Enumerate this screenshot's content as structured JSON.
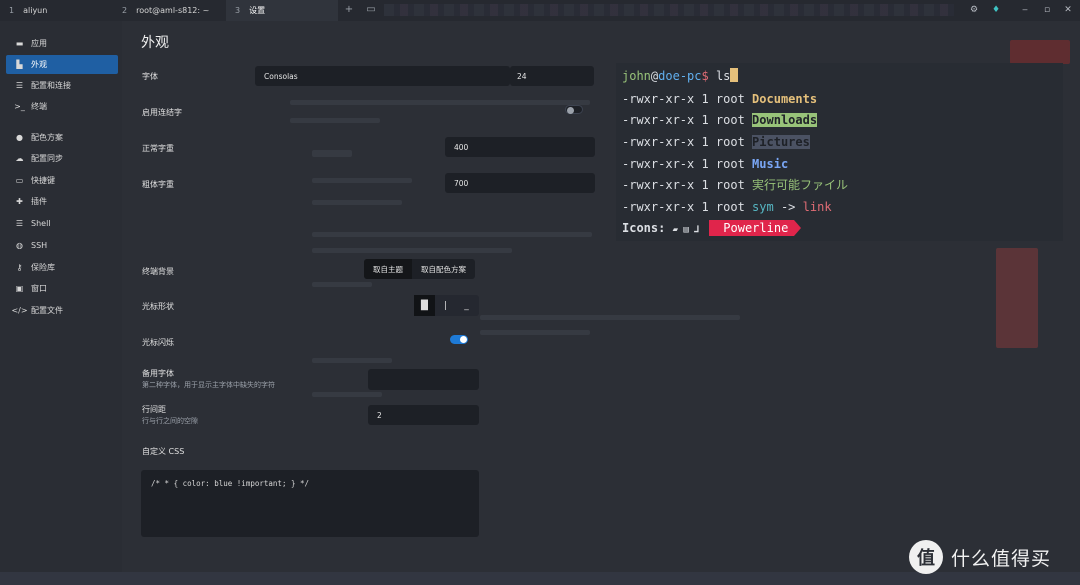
{
  "tabs": [
    {
      "num": "1",
      "label": "aliyun"
    },
    {
      "num": "2",
      "label": "root@aml-s812: ~"
    },
    {
      "num": "3",
      "label": "设置"
    }
  ],
  "tab_actions": {
    "new_tab": "+",
    "split": "▭"
  },
  "window_controls": {
    "settings": "⚙",
    "gift": "♦",
    "minimize": "‒",
    "maximize": "▫",
    "close": "✕"
  },
  "sidebar": {
    "items": [
      {
        "label": "应用",
        "icon": "window-icon"
      },
      {
        "label": "外观",
        "icon": "palette-icon"
      },
      {
        "label": "配置和连接",
        "icon": "list-icon"
      },
      {
        "label": "终端",
        "icon": "terminal-icon"
      },
      {
        "label": "配色方案",
        "icon": "color-icon"
      },
      {
        "label": "配置同步",
        "icon": "cloud-icon"
      },
      {
        "label": "快捷键",
        "icon": "keyboard-icon"
      },
      {
        "label": "插件",
        "icon": "puzzle-icon"
      },
      {
        "label": "Shell",
        "icon": "list-icon"
      },
      {
        "label": "SSH",
        "icon": "globe-icon"
      },
      {
        "label": "保险库",
        "icon": "key-icon"
      },
      {
        "label": "窗口",
        "icon": "window-icon"
      },
      {
        "label": "配置文件",
        "icon": "code-icon"
      }
    ]
  },
  "page": {
    "title": "外观",
    "font_label": "字体",
    "font_value": "Consolas",
    "font_size": "24",
    "ligatures_label": "启用连结字",
    "ligatures_on": false,
    "normal_weight_label": "正常字重",
    "normal_weight": "400",
    "bold_weight_label": "粗体字重",
    "bold_weight": "700",
    "bg_label": "终端背景",
    "bg_options": [
      "取自主题",
      "取自配色方案"
    ],
    "cursor_shape_label": "光标形状",
    "cursor_options": [
      "█",
      "|",
      "_"
    ],
    "cursor_blink_label": "光标闪烁",
    "cursor_blink_on": true,
    "fallback_font_label": "备用字体",
    "fallback_font_desc": "第二种字体，用于显示主字体中缺失的字符",
    "fallback_font_value": "",
    "line_spacing_label": "行间距",
    "line_spacing_desc": "行与行之间的空隙",
    "line_spacing_value": "2",
    "custom_css_label": "自定义 CSS",
    "custom_css_value": "/* * { color: blue !important; } */"
  },
  "terminal": {
    "user": "john",
    "at": "@",
    "host": "doe-pc",
    "prompt": "$",
    "command": " ls",
    "lines": [
      {
        "perm": "-rwxr-xr-x 1 root ",
        "name": "Documents"
      },
      {
        "perm": "-rwxr-xr-x 1 root ",
        "name": "Downloads"
      },
      {
        "perm": "-rwxr-xr-x 1 root ",
        "name": "Pictures"
      },
      {
        "perm": "-rwxr-xr-x 1 root ",
        "name": "Music"
      },
      {
        "perm": "-rwxr-xr-x 1 root ",
        "name": "実行可能ファイル"
      },
      {
        "perm": "-rwxr-xr-x 1 root ",
        "name": "sym",
        "arrow": " -> ",
        "target": "link"
      }
    ],
    "icons_label": "Icons: ",
    "icon_glyphs": "▰ ▤ ⅃",
    "powerline": "Powerline"
  },
  "watermark": {
    "logo": "值",
    "text": "什么值得买"
  },
  "colors": {
    "accent": "#1f5fa3",
    "toggle_on": "#1e7ad6",
    "powerline": "#e0254b"
  }
}
